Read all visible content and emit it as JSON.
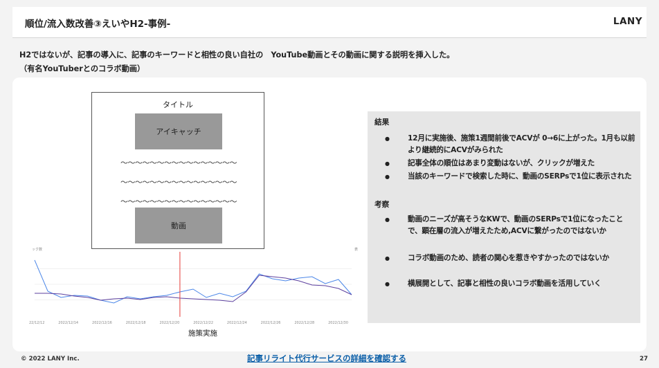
{
  "header": {
    "title": "順位/流入数改善③えいやH2-事例-",
    "brand": "LANY"
  },
  "description": {
    "line1": "H2ではないが、記事の導入に、記事のキーワードと相性の良い自社の　YouTube動画とその動画に関する説明を挿入した。",
    "line2": "（有名YouTuberとのコラボ動画）"
  },
  "mockup": {
    "title": "タイトル",
    "eyecatch": "アイキャッチ",
    "wave": "〜〜〜〜〜〜〜〜〜〜〜〜〜〜〜〜",
    "video": "動画"
  },
  "chart_data": {
    "type": "line",
    "title": "",
    "y_left_label": "ック数",
    "y_right_label": "表",
    "x": [
      "2022/12/12",
      "2022/12/14",
      "2022/12/16",
      "2022/12/18",
      "2022/12/20",
      "2022/12/22",
      "2022/12/24",
      "2022/12/26",
      "2022/12/28",
      "2022/12/30"
    ],
    "series": [
      {
        "color": "#4a86e8",
        "values": [
          8,
          3.5,
          2.6,
          2.9,
          2.8,
          2.2,
          1.8,
          2.7,
          2.4,
          2.7,
          2.9,
          3.4,
          3.8,
          2.6,
          3.2,
          2.7,
          3.5,
          6.0,
          5.3,
          5.0,
          5.4,
          5.6,
          4.6,
          5.2,
          3.0
        ]
      },
      {
        "color": "#5b3f9e",
        "values": [
          3.2,
          3.2,
          3.1,
          2.8,
          2.6,
          2.2,
          2.4,
          2.5,
          2.3,
          2.6,
          2.7,
          2.5,
          2.4,
          2.3,
          2.2,
          2.0,
          3.4,
          5.8,
          5.6,
          5.4,
          5.0,
          4.4,
          4.3,
          3.9,
          3.0
        ]
      }
    ],
    "event_marker": {
      "index": 11,
      "color": "#e53935"
    },
    "caption": "施策実施"
  },
  "results": {
    "heading1": "結果",
    "result_items": [
      "12月に実施後、施策1週間前後でACVが 0→6に上がった。1月も以前より継続的にACVがみられた",
      "記事全体の順位はあまり変動はないが、クリックが増えた",
      "当該のキーワードで検索した時に、動画のSERPsで1位に表示された"
    ],
    "heading2": "考察",
    "consider_items": [
      "動画のニーズが高そうなKWで、動画のSERPsで1位になったことで、顕在層の流入が増えたため,ACVに繋がったのではないか",
      "コラボ動画のため、読者の関心を惹きやすかったのではないか",
      "横展開として、記事と相性の良いコラボ動画を活用していく"
    ]
  },
  "footer": {
    "copyright": "© 2022 LANY Inc.",
    "link": "記事リライト代行サービスの詳細を確認する",
    "page": "27"
  }
}
